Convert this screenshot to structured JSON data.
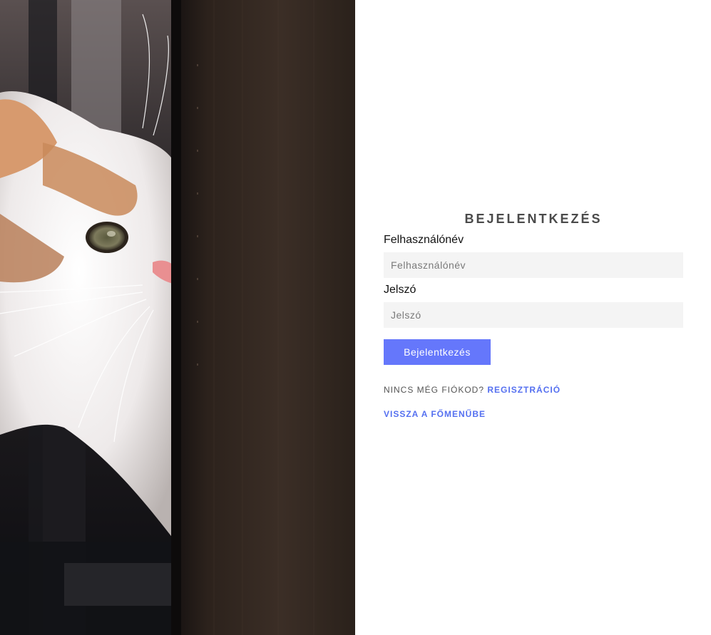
{
  "login": {
    "title": "BEJELENTKEZÉS",
    "username_label": "Felhasználónév",
    "username_placeholder": "Felhasználónév",
    "username_value": "",
    "password_label": "Jelszó",
    "password_placeholder": "Jelszó",
    "password_value": "",
    "submit_label": "Bejelentkezés",
    "no_account_text": "NINCS MÉG FIÓKOD?",
    "register_link": "REGISZTRÁCIÓ",
    "back_link": "VISSZA A FŐMENŰBE"
  },
  "colors": {
    "accent": "#6577fb",
    "link": "#5570f0",
    "field_bg": "#f4f4f4",
    "title": "#4a4a4a"
  },
  "image": {
    "subject": "cat-peeking-photo"
  }
}
